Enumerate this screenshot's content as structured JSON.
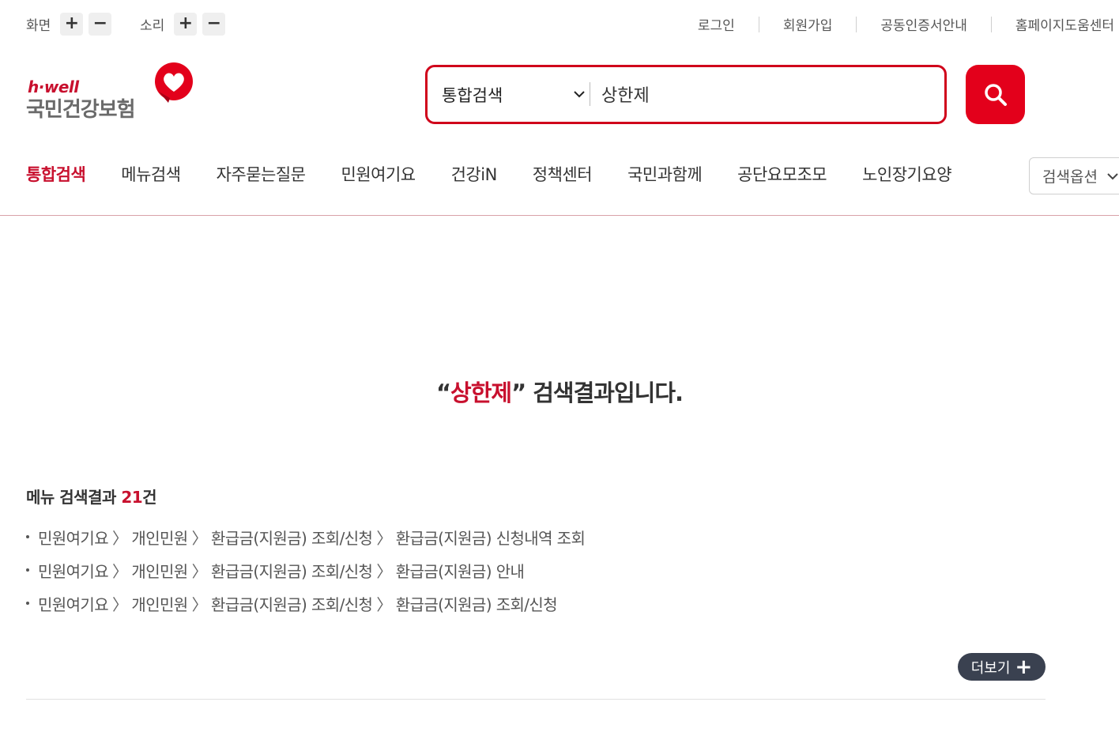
{
  "util": {
    "screen_label": "화면",
    "sound_label": "소리",
    "plus": "+",
    "minus": "−",
    "links": [
      "로그인",
      "회원가입",
      "공동인증서안내",
      "홈페이지도움센터"
    ]
  },
  "logo": {
    "hwell": "h·well",
    "name": "국민건강보험"
  },
  "search": {
    "category": "통합검색",
    "query": "상한제"
  },
  "tabs": [
    "통합검색",
    "메뉴검색",
    "자주묻는질문",
    "민원여기요",
    "건강iN",
    "정책센터",
    "국민과함께",
    "공단요모조모",
    "노인장기요양"
  ],
  "search_option": "검색옵션",
  "result": {
    "quote_open": "“",
    "keyword": "상한제",
    "quote_close": "”",
    "suffix": " 검색결과입니다."
  },
  "menu_results": {
    "head_prefix": "메뉴 검색결과 ",
    "count": "21",
    "head_suffix": "건",
    "items": [
      [
        "민원여기요",
        "개인민원",
        "환급금(지원금) 조회/신청",
        "환급금(지원금) 신청내역 조회"
      ],
      [
        "민원여기요",
        "개인민원",
        "환급금(지원금) 조회/신청",
        "환급금(지원금) 안내"
      ],
      [
        "민원여기요",
        "개인민원",
        "환급금(지원금) 조회/신청",
        "환급금(지원금) 조회/신청"
      ]
    ],
    "more_label": "더보기"
  },
  "colors": {
    "brand_red": "#c8102e",
    "search_button": "#e3001b",
    "more_button": "#3a4150"
  }
}
